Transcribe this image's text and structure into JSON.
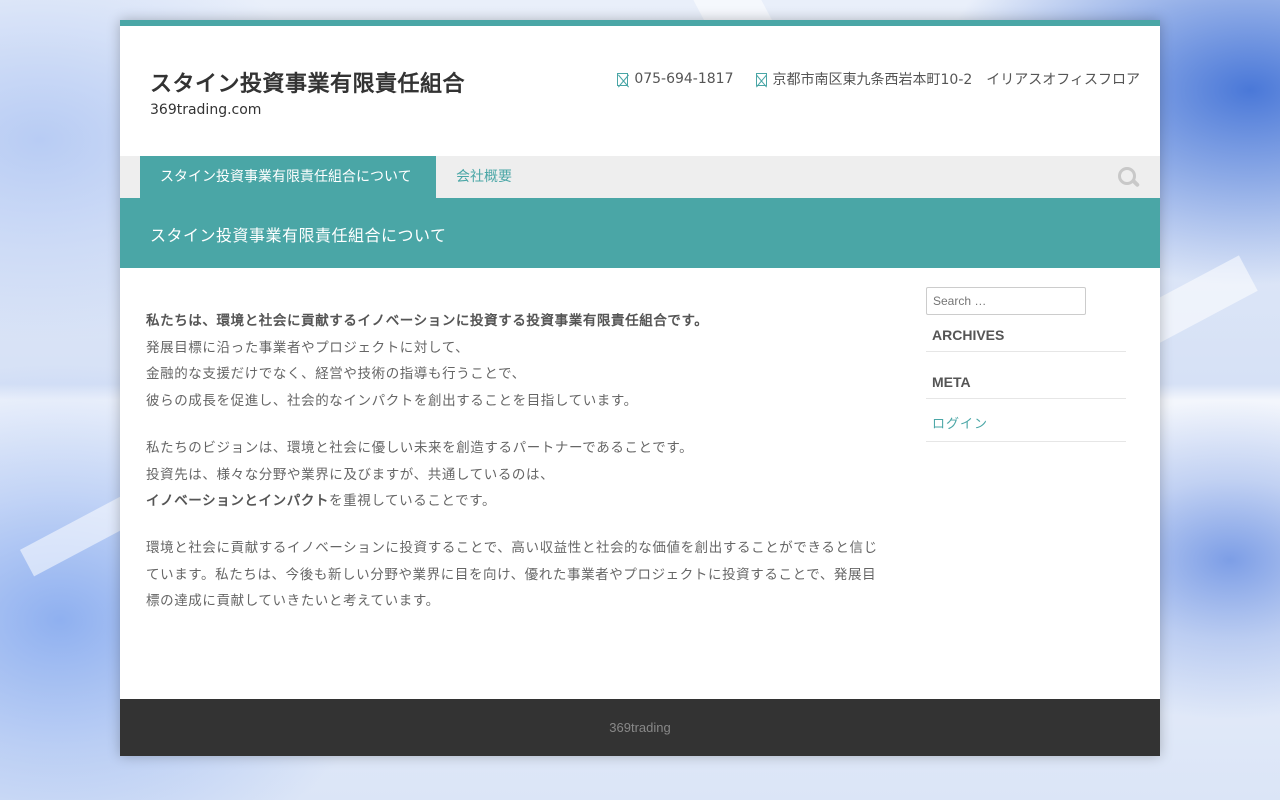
{
  "header": {
    "site_title": "スタイン投資事業有限責任組合",
    "site_description": "369trading.com",
    "phone": "075-694-1817",
    "address": "京都市南区東九条西岩本町10-2　イリアスオフィスフロア"
  },
  "nav": {
    "items": [
      {
        "label": "スタイン投資事業有限責任組合について"
      },
      {
        "label": "会社概要"
      }
    ]
  },
  "page": {
    "title": "スタイン投資事業有限責任組合について"
  },
  "content": {
    "p1_bold": "私たちは、環境と社会に貢献するイノベーションに投資する投資事業有限責任組合です。",
    "p1_line2": "発展目標に沿った事業者やプロジェクトに対して、",
    "p1_line3": "金融的な支援だけでなく、経営や技術の指導も行うことで、",
    "p1_line4": "彼らの成長を促進し、社会的なインパクトを創出することを目指しています。",
    "p2_line1": "私たちのビジョンは、環境と社会に優しい未来を創造するパートナーであることです。",
    "p2_line2": "投資先は、様々な分野や業界に及びますが、共通しているのは、",
    "p2_line3_bold": "イノベーションとインパクト",
    "p2_line3_rest": "を重視していることです。",
    "p3": "環境と社会に貢献するイノベーションに投資することで、高い収益性と社会的な価値を創出することができると信じています。私たちは、今後も新しい分野や業界に目を向け、優れた事業者やプロジェクトに投資することで、発展目標の達成に貢献していきたいと考えています。"
  },
  "sidebar": {
    "search_placeholder": "Search …",
    "archives_title": "ARCHIVES",
    "meta_title": "META",
    "login_label": "ログイン"
  },
  "footer": {
    "text": "369trading"
  },
  "colors": {
    "accent": "#4aa6a6",
    "footer_bg": "#333333",
    "nav_bg": "#eeeeee"
  }
}
